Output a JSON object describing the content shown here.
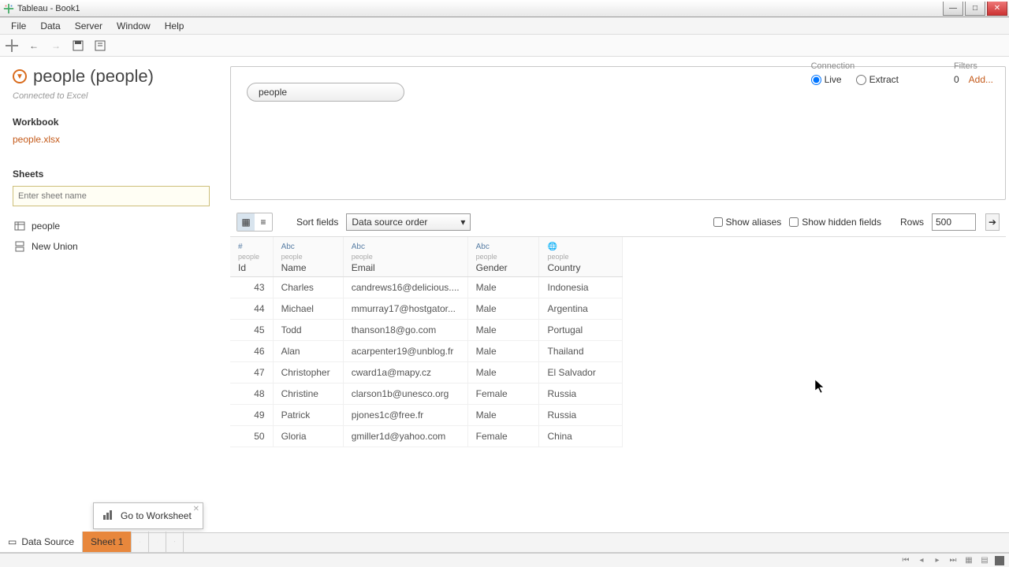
{
  "window": {
    "title": "Tableau - Book1"
  },
  "menu": {
    "file": "File",
    "data": "Data",
    "server": "Server",
    "window": "Window",
    "help": "Help"
  },
  "datasource": {
    "name": "people (people)",
    "connected": "Connected to Excel"
  },
  "workbook": {
    "header": "Workbook",
    "file": "people.xlsx"
  },
  "sheets": {
    "header": "Sheets",
    "placeholder": "Enter sheet name",
    "items": [
      "people",
      "New Union"
    ]
  },
  "canvas": {
    "pill": "people"
  },
  "connection": {
    "label": "Connection",
    "live": "Live",
    "extract": "Extract"
  },
  "filters": {
    "label": "Filters",
    "count": "0",
    "add": "Add..."
  },
  "controls": {
    "sort_label": "Sort fields",
    "sort_value": "Data source order",
    "aliases": "Show aliases",
    "hidden": "Show hidden fields",
    "rows_label": "Rows",
    "rows_value": "500"
  },
  "columns": [
    {
      "type": "#",
      "table": "people",
      "name": "Id"
    },
    {
      "type": "Abc",
      "table": "people",
      "name": "Name"
    },
    {
      "type": "Abc",
      "table": "people",
      "name": "Email"
    },
    {
      "type": "Abc",
      "table": "people",
      "name": "Gender"
    },
    {
      "type": "🌐",
      "table": "people",
      "name": "Country"
    }
  ],
  "rows": [
    {
      "id": "43",
      "name": "Charles",
      "email": "candrews16@delicious....",
      "gender": "Male",
      "country": "Indonesia"
    },
    {
      "id": "44",
      "name": "Michael",
      "email": "mmurray17@hostgator...",
      "gender": "Male",
      "country": "Argentina"
    },
    {
      "id": "45",
      "name": "Todd",
      "email": "thanson18@go.com",
      "gender": "Male",
      "country": "Portugal"
    },
    {
      "id": "46",
      "name": "Alan",
      "email": "acarpenter19@unblog.fr",
      "gender": "Male",
      "country": "Thailand"
    },
    {
      "id": "47",
      "name": "Christopher",
      "email": "cward1a@mapy.cz",
      "gender": "Male",
      "country": "El Salvador"
    },
    {
      "id": "48",
      "name": "Christine",
      "email": "clarson1b@unesco.org",
      "gender": "Female",
      "country": "Russia"
    },
    {
      "id": "49",
      "name": "Patrick",
      "email": "pjones1c@free.fr",
      "gender": "Male",
      "country": "Russia"
    },
    {
      "id": "50",
      "name": "Gloria",
      "email": "gmiller1d@yahoo.com",
      "gender": "Female",
      "country": "China"
    }
  ],
  "popup": {
    "label": "Go to Worksheet"
  },
  "tabs": {
    "ds": "Data Source",
    "sheet": "Sheet 1"
  }
}
